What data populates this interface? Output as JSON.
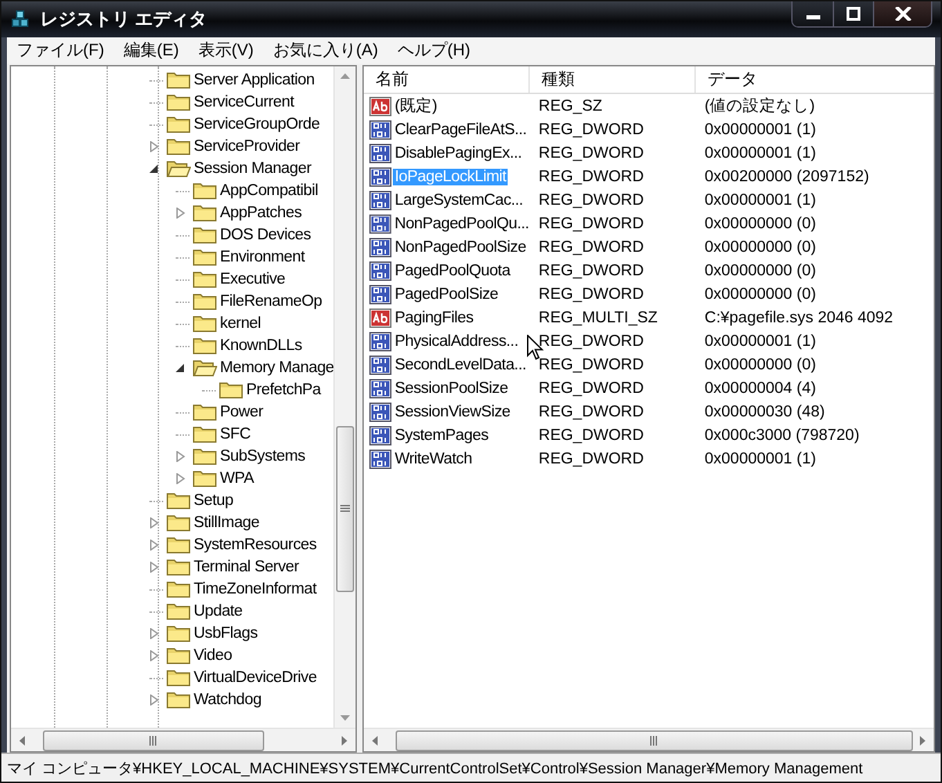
{
  "window": {
    "title": "レジストリ エディタ"
  },
  "menu": [
    {
      "label": "ファイル(F)"
    },
    {
      "label": "編集(E)"
    },
    {
      "label": "表示(V)"
    },
    {
      "label": "お気に入り(A)"
    },
    {
      "label": "ヘルプ(H)"
    }
  ],
  "tree": {
    "items": [
      {
        "label": "Server Application",
        "expandable": false,
        "expanded": false
      },
      {
        "label": "ServiceCurrent",
        "expandable": false,
        "expanded": false
      },
      {
        "label": "ServiceGroupOrde",
        "expandable": false,
        "expanded": false
      },
      {
        "label": "ServiceProvider",
        "expandable": true,
        "expanded": false
      },
      {
        "label": "Session Manager",
        "expandable": true,
        "expanded": true,
        "children": [
          {
            "label": "AppCompatibil",
            "expandable": false,
            "expanded": false
          },
          {
            "label": "AppPatches",
            "expandable": true,
            "expanded": false
          },
          {
            "label": "DOS Devices",
            "expandable": false,
            "expanded": false
          },
          {
            "label": "Environment",
            "expandable": false,
            "expanded": false
          },
          {
            "label": "Executive",
            "expandable": false,
            "expanded": false
          },
          {
            "label": "FileRenameOp",
            "expandable": false,
            "expanded": false
          },
          {
            "label": "kernel",
            "expandable": false,
            "expanded": false
          },
          {
            "label": "KnownDLLs",
            "expandable": false,
            "expanded": false
          },
          {
            "label": "Memory Manage",
            "expandable": true,
            "expanded": true,
            "children": [
              {
                "label": "PrefetchPa",
                "expandable": false,
                "expanded": false
              }
            ]
          },
          {
            "label": "Power",
            "expandable": false,
            "expanded": false
          },
          {
            "label": "SFC",
            "expandable": false,
            "expanded": false
          },
          {
            "label": "SubSystems",
            "expandable": true,
            "expanded": false
          },
          {
            "label": "WPA",
            "expandable": true,
            "expanded": false
          }
        ]
      },
      {
        "label": "Setup",
        "expandable": false,
        "expanded": false
      },
      {
        "label": "StillImage",
        "expandable": true,
        "expanded": false
      },
      {
        "label": "SystemResources",
        "expandable": true,
        "expanded": false
      },
      {
        "label": "Terminal Server",
        "expandable": true,
        "expanded": false
      },
      {
        "label": "TimeZoneInformat",
        "expandable": false,
        "expanded": false
      },
      {
        "label": "Update",
        "expandable": false,
        "expanded": false
      },
      {
        "label": "UsbFlags",
        "expandable": true,
        "expanded": false
      },
      {
        "label": "Video",
        "expandable": true,
        "expanded": false
      },
      {
        "label": "VirtualDeviceDrive",
        "expandable": false,
        "expanded": false
      },
      {
        "label": "Watchdog",
        "expandable": true,
        "expanded": false
      }
    ]
  },
  "values": {
    "columns": [
      "名前",
      "種類",
      "データ"
    ],
    "rows": [
      {
        "kind": "string",
        "name": "(既定)",
        "type": "REG_SZ",
        "data": "(値の設定なし)",
        "selected": false
      },
      {
        "kind": "binary",
        "name": "ClearPageFileAtS...",
        "type": "REG_DWORD",
        "data": "0x00000001 (1)",
        "selected": false
      },
      {
        "kind": "binary",
        "name": "DisablePagingEx...",
        "type": "REG_DWORD",
        "data": "0x00000001 (1)",
        "selected": false
      },
      {
        "kind": "binary",
        "name": "IoPageLockLimit",
        "type": "REG_DWORD",
        "data": "0x00200000 (2097152)",
        "selected": true
      },
      {
        "kind": "binary",
        "name": "LargeSystemCac...",
        "type": "REG_DWORD",
        "data": "0x00000001 (1)",
        "selected": false
      },
      {
        "kind": "binary",
        "name": "NonPagedPoolQu...",
        "type": "REG_DWORD",
        "data": "0x00000000 (0)",
        "selected": false
      },
      {
        "kind": "binary",
        "name": "NonPagedPoolSize",
        "type": "REG_DWORD",
        "data": "0x00000000 (0)",
        "selected": false
      },
      {
        "kind": "binary",
        "name": "PagedPoolQuota",
        "type": "REG_DWORD",
        "data": "0x00000000 (0)",
        "selected": false
      },
      {
        "kind": "binary",
        "name": "PagedPoolSize",
        "type": "REG_DWORD",
        "data": "0x00000000 (0)",
        "selected": false
      },
      {
        "kind": "string",
        "name": "PagingFiles",
        "type": "REG_MULTI_SZ",
        "data": "C:¥pagefile.sys 2046 4092",
        "selected": false
      },
      {
        "kind": "binary",
        "name": "PhysicalAddress...",
        "type": "REG_DWORD",
        "data": "0x00000001 (1)",
        "selected": false
      },
      {
        "kind": "binary",
        "name": "SecondLevelData...",
        "type": "REG_DWORD",
        "data": "0x00000000 (0)",
        "selected": false
      },
      {
        "kind": "binary",
        "name": "SessionPoolSize",
        "type": "REG_DWORD",
        "data": "0x00000004 (4)",
        "selected": false
      },
      {
        "kind": "binary",
        "name": "SessionViewSize",
        "type": "REG_DWORD",
        "data": "0x00000030 (48)",
        "selected": false
      },
      {
        "kind": "binary",
        "name": "SystemPages",
        "type": "REG_DWORD",
        "data": "0x000c3000 (798720)",
        "selected": false
      },
      {
        "kind": "binary",
        "name": "WriteWatch",
        "type": "REG_DWORD",
        "data": "0x00000001 (1)",
        "selected": false
      }
    ]
  },
  "status_bar": "マイ コンピュータ¥HKEY_LOCAL_MACHINE¥SYSTEM¥CurrentControlSet¥Control¥Session Manager¥Memory Management"
}
